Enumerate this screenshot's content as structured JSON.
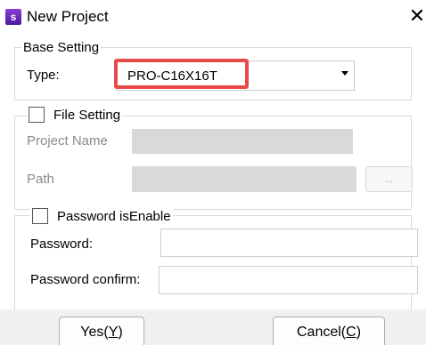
{
  "window": {
    "title": "New Project",
    "icon_letter": "s",
    "close_glyph": "✕"
  },
  "base_setting": {
    "title": "Base Setting",
    "type_label": "Type:",
    "type_value": "PRO-C16X16T"
  },
  "file_setting": {
    "title": "File Setting",
    "project_name_label": "Project Name",
    "path_label": "Path",
    "browse_label": "..."
  },
  "password_setting": {
    "title": "Password isEnable",
    "password_label": "Password:",
    "password_confirm_label": "Password confirm:"
  },
  "footer": {
    "yes_text": "Yes(",
    "yes_key": "Y",
    "yes_close": ")",
    "cancel_text": "Cancel(",
    "cancel_key": "C",
    "cancel_close": ")"
  },
  "colors": {
    "highlight": "#e84a4a",
    "disabled_field": "#d9d9d9",
    "footer_bg": "#f0f0f0"
  }
}
